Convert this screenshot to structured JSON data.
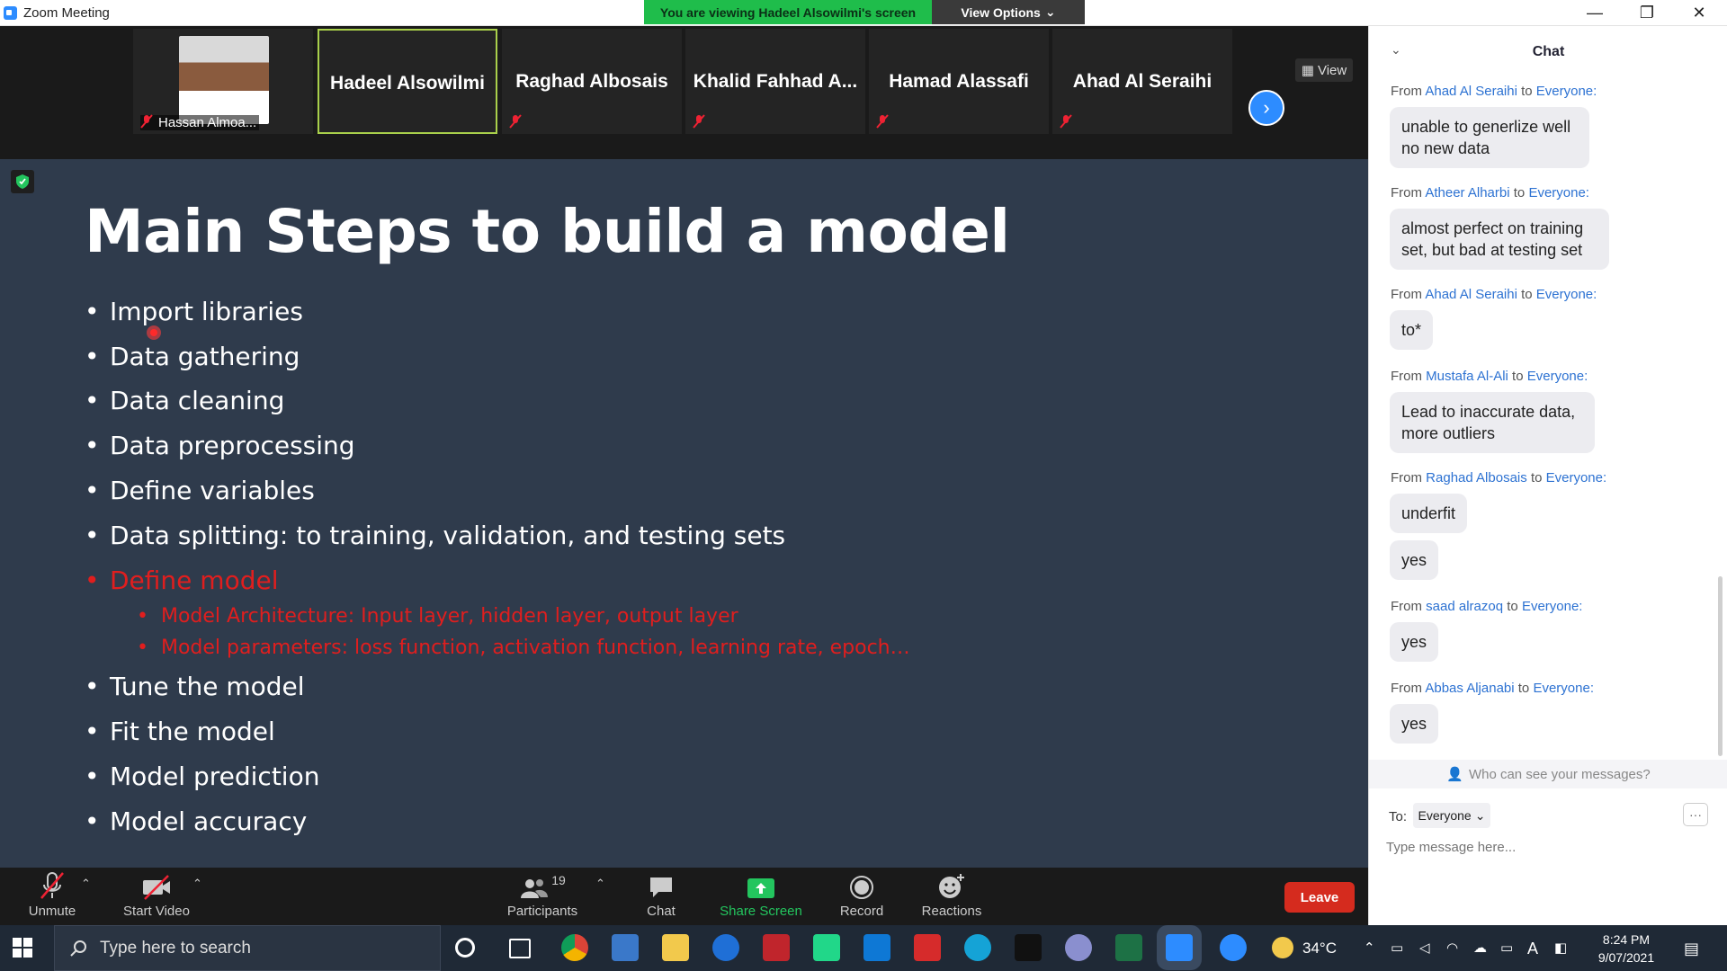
{
  "window": {
    "title": "Zoom Meeting",
    "banner": "You are viewing Hadeel Alsowilmi's screen",
    "view_options": "View Options",
    "minimize": "—",
    "restore": "❐",
    "close": "✕"
  },
  "thumbnails": [
    {
      "name": "Hassan Almoa...",
      "has_photo": true,
      "muted": true
    },
    {
      "name": "Hadeel Alsowilmi",
      "active": true,
      "muted": false
    },
    {
      "name": "Raghad Albosais",
      "muted": true
    },
    {
      "name": "Khalid  Fahhad  A...",
      "muted": true
    },
    {
      "name": "Hamad Alassafi",
      "muted": true
    },
    {
      "name": "Ahad Al Seraihi",
      "muted": true
    }
  ],
  "view_button": "View",
  "slide": {
    "title": "Main Steps to build a model",
    "bullets": [
      "Import libraries",
      "Data gathering",
      "Data cleaning",
      "Data preprocessing",
      "Define variables",
      "Data splitting: to training, validation, and testing sets",
      "Define model",
      "Tune the model",
      "Fit the model",
      "Model prediction",
      "Model accuracy"
    ],
    "sub_bullets": [
      "Model Architecture: Input layer, hidden layer, output layer",
      "Model parameters: loss function, activation function, learning rate, epoch…"
    ],
    "highlight_color": "#e01e1e"
  },
  "toolbar": {
    "unmute": "Unmute",
    "start_video": "Start Video",
    "participants": "Participants",
    "participants_count": "19",
    "chat": "Chat",
    "share_screen": "Share Screen",
    "record": "Record",
    "reactions": "Reactions",
    "leave": "Leave"
  },
  "chat": {
    "title": "Chat",
    "messages": [
      {
        "from": "Ahad Al Seraihi",
        "to": "Everyone:",
        "texts": [
          "unable to generlize well no new data"
        ]
      },
      {
        "from": "Atheer Alharbi",
        "to": "Everyone:",
        "texts": [
          "almost perfect on training set, but bad at testing set"
        ]
      },
      {
        "from": "Ahad Al Seraihi",
        "to": "Everyone:",
        "texts": [
          "to*"
        ]
      },
      {
        "from": "Mustafa Al-Ali",
        "to": "Everyone:",
        "texts": [
          "Lead to inaccurate data, more outliers"
        ]
      },
      {
        "from": "Raghad Albosais",
        "to": "Everyone:",
        "texts": [
          "underfit",
          "yes"
        ]
      },
      {
        "from": "saad alrazoq",
        "to": "Everyone:",
        "texts": [
          "yes"
        ]
      },
      {
        "from": "Abbas Aljanabi",
        "to": "Everyone:",
        "texts": [
          "yes"
        ]
      }
    ],
    "from_word": "From",
    "to_word": "to",
    "who_can_see": "Who can see your messages?",
    "to_label": "To:",
    "recipient": "Everyone",
    "more": "···",
    "placeholder": "Type message here..."
  },
  "taskbar": {
    "search_placeholder": "Type here to search",
    "temperature": "34°C",
    "time": "8:24 PM",
    "date": "9/07/2021"
  }
}
